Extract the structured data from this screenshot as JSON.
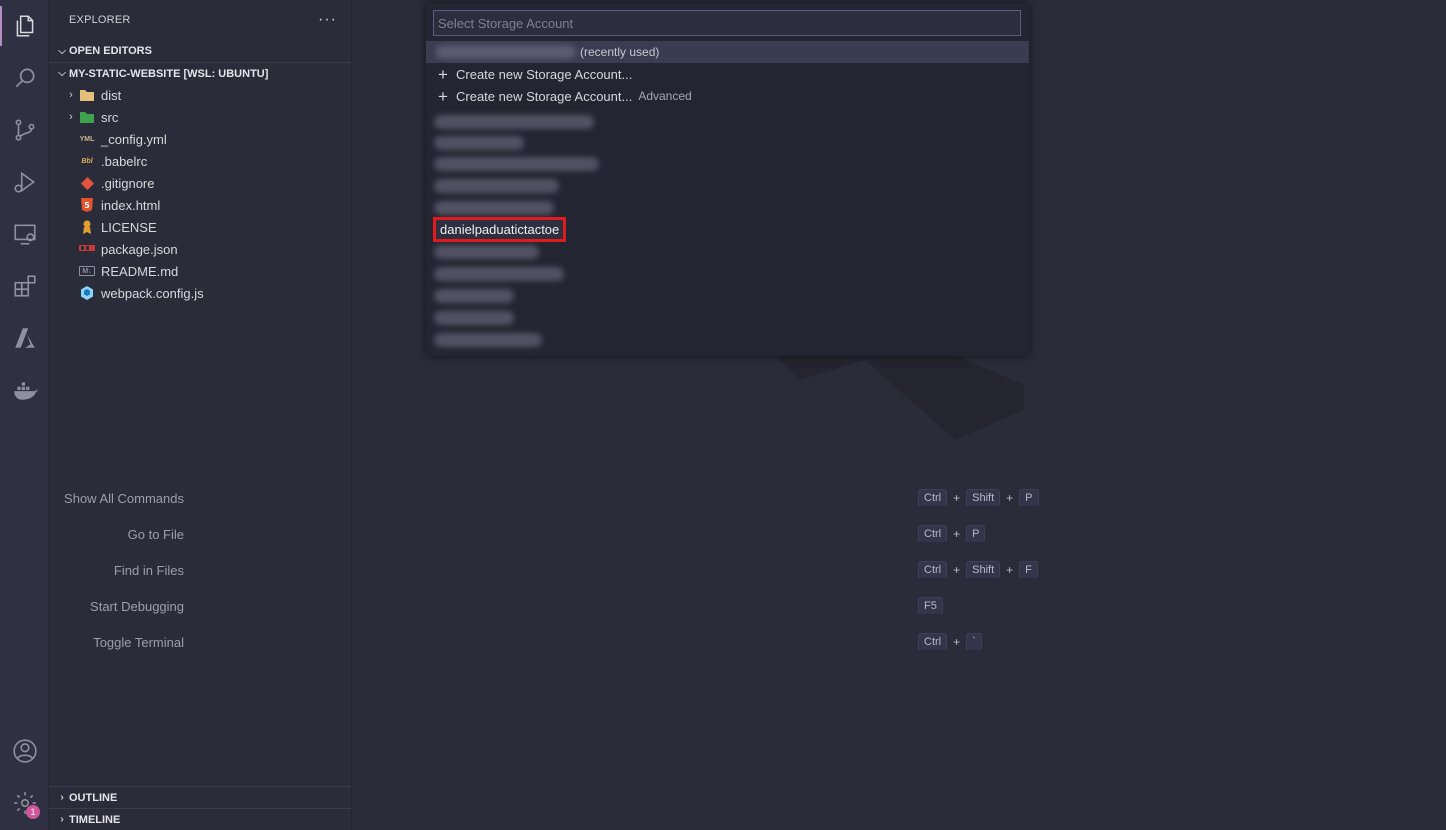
{
  "sidebar": {
    "header": "EXPLORER",
    "more": "···",
    "open_editors": "OPEN EDITORS",
    "workspace": "MY-STATIC-WEBSITE [WSL: UBUNTU]",
    "files": [
      {
        "name": "dist",
        "type": "folder",
        "icon": "folder-dist-icon"
      },
      {
        "name": "src",
        "type": "folder",
        "icon": "folder-src-icon"
      },
      {
        "name": "_config.yml",
        "type": "file",
        "icon": "yaml-icon"
      },
      {
        "name": ".babelrc",
        "type": "file",
        "icon": "babel-icon"
      },
      {
        "name": ".gitignore",
        "type": "file",
        "icon": "git-icon"
      },
      {
        "name": "index.html",
        "type": "file",
        "icon": "html5-icon"
      },
      {
        "name": "LICENSE",
        "type": "file",
        "icon": "license-icon"
      },
      {
        "name": "package.json",
        "type": "file",
        "icon": "npm-icon"
      },
      {
        "name": "README.md",
        "type": "file",
        "icon": "markdown-icon"
      },
      {
        "name": "webpack.config.js",
        "type": "file",
        "icon": "webpack-icon"
      }
    ],
    "outline": "OUTLINE",
    "timeline": "TIMELINE"
  },
  "activity_bar": {
    "items": [
      "explorer-icon",
      "search-icon",
      "source-control-icon",
      "run-debug-icon",
      "remote-explorer-icon",
      "extensions-icon",
      "azure-icon",
      "docker-icon"
    ],
    "bottom": [
      "account-icon",
      "settings-gear-icon"
    ],
    "settings_badge": "1"
  },
  "quick_pick": {
    "placeholder": "Select Storage Account",
    "recent_label": "(recently used)",
    "create_label": "Create new Storage Account...",
    "create_advanced_label": "Create new Storage Account...",
    "advanced_desc": "Advanced",
    "highlighted_account": "danielpaduatictactoe"
  },
  "shortcuts": [
    {
      "label": "Show All Commands",
      "keys": [
        "Ctrl",
        "Shift",
        "P"
      ]
    },
    {
      "label": "Go to File",
      "keys": [
        "Ctrl",
        "P"
      ]
    },
    {
      "label": "Find in Files",
      "keys": [
        "Ctrl",
        "Shift",
        "F"
      ]
    },
    {
      "label": "Start Debugging",
      "keys": [
        "F5"
      ]
    },
    {
      "label": "Toggle Terminal",
      "keys": [
        "Ctrl",
        "`"
      ]
    }
  ],
  "colors": {
    "accent": "#b58ec1",
    "highlight_border": "#e01b1b",
    "badge": "#d0569a"
  }
}
